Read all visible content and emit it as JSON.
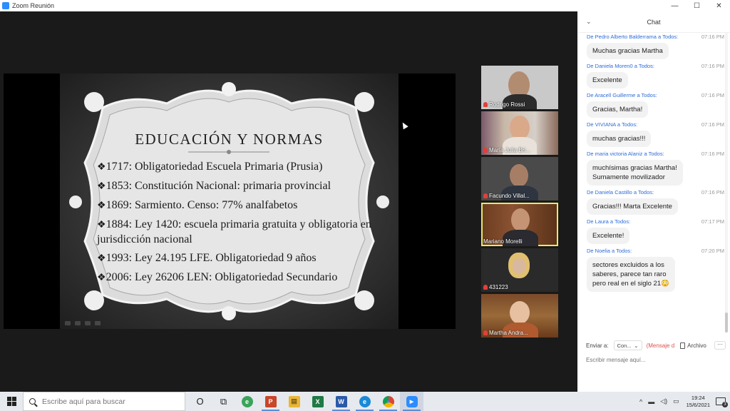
{
  "window": {
    "title": "Zoom Reunión",
    "controls": [
      "—",
      "☐",
      "✕"
    ]
  },
  "slide": {
    "heading": "EDUCACIÓN Y NORMAS",
    "bullets": [
      "1717: Obligatoriedad Escuela Primaria (Prusia)",
      "1853: Constitución Nacional: primaria provincial",
      "1869: Sarmiento. Censo: 77% analfabetos",
      "1884: Ley 1420: escuela primaria gratuita y obligatoria en jurisdicción nacional",
      "1993: Ley 24.195 LFE. Obligatoriedad 9 años",
      "2006: Ley 26206 LEN: Obligatoriedad Secundario"
    ],
    "bullet_symbol": "❖"
  },
  "participants": [
    {
      "name": "Rodrigo Rossi",
      "muted": true
    },
    {
      "name": "María Julia Bri...",
      "muted": true
    },
    {
      "name": "Facundo Villal...",
      "muted": true
    },
    {
      "name": "Mariano Morelli",
      "muted": false,
      "active_speaker": true
    },
    {
      "name": "431223",
      "muted": true
    },
    {
      "name": "Martha Andra...",
      "muted": true
    }
  ],
  "chat": {
    "title": "Chat",
    "messages": [
      {
        "from": "De Pedro Alberto Balderrama a Todos:",
        "time": "07:16 PM",
        "text": "Muchas gracias Martha"
      },
      {
        "from": "De Daniela Moren0 a Todos:",
        "time": "07:16 PM",
        "text": "Excelente"
      },
      {
        "from": "De Aracell Guillerme a Todos:",
        "time": "07:16 PM",
        "text": "Gracias, Martha!"
      },
      {
        "from": "De VIVIANA a Todos:",
        "time": "07:16 PM",
        "text": "muchas gracias!!!"
      },
      {
        "from": "De maria victoria Alaniz a Todos:",
        "time": "07:16 PM",
        "text": "muchísimas gracias Martha!\nSumamente movilizador"
      },
      {
        "from": "De Daniela Castillo a Todos:",
        "time": "07:16 PM",
        "text": "Gracias!!! Marta Excelente"
      },
      {
        "from": "De Laura a Todos:",
        "time": "07:17 PM",
        "text": "Excelente!"
      },
      {
        "from": "De Noelia a Todos:",
        "time": "07:20 PM",
        "text": "sectores excluidos a los\nsaberes, parece tan  raro\npero real en el siglo 21😳"
      }
    ],
    "send_to_label": "Enviar a:",
    "send_to_value": "Con...",
    "private_hint": "(Mensaje d",
    "file_label": "Archivo",
    "more_label": "···",
    "compose_placeholder": "Escribir mensaje aquí..."
  },
  "taskbar": {
    "search_placeholder": "Escribe aquí para buscar",
    "apps": [
      {
        "name": "cortana",
        "glyph": "O"
      },
      {
        "name": "task-view",
        "glyph": "⧉"
      },
      {
        "name": "browser-green",
        "glyph": "e"
      },
      {
        "name": "powerpoint",
        "glyph": "P"
      },
      {
        "name": "file-explorer",
        "glyph": "▤"
      },
      {
        "name": "excel",
        "glyph": "X"
      },
      {
        "name": "word",
        "glyph": "W"
      },
      {
        "name": "edge",
        "glyph": "e"
      },
      {
        "name": "chrome",
        "glyph": "●"
      },
      {
        "name": "zoom",
        "glyph": "▶"
      }
    ],
    "time": "19:24",
    "date": "15/6/2021",
    "notifications": "3"
  },
  "colors": {
    "zoom_blue": "#2d8cff",
    "chat_sender": "#2d6cd9",
    "active_speaker": "#e8e86e",
    "muted_red": "#e0403a"
  }
}
